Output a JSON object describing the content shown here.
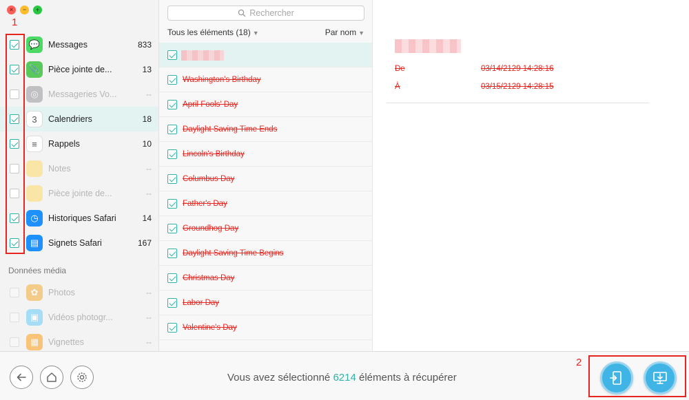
{
  "window_controls": {
    "close": "×",
    "minimize": "−",
    "zoom": "+"
  },
  "sidebar": {
    "items": [
      {
        "label": "Messages",
        "count": "833",
        "checked": true,
        "dim": false,
        "icon": "messages-icon",
        "color": "#4cd964"
      },
      {
        "label": "Pièce jointe de...",
        "count": "13",
        "checked": true,
        "dim": false,
        "icon": "attachment-icon",
        "color": "#5ac85a"
      },
      {
        "label": "Messageries Vo...",
        "count": "--",
        "checked": false,
        "dim": true,
        "icon": "voicemail-icon",
        "color": "#8e8e93"
      },
      {
        "label": "Calendriers",
        "count": "18",
        "checked": true,
        "dim": false,
        "icon": "calendar-icon",
        "color": "#ffffff",
        "selected": true
      },
      {
        "label": "Rappels",
        "count": "10",
        "checked": true,
        "dim": false,
        "icon": "reminders-icon",
        "color": "#ffffff"
      },
      {
        "label": "Notes",
        "count": "--",
        "checked": false,
        "dim": true,
        "icon": "notes-icon",
        "color": "#ffd95a"
      },
      {
        "label": "Pièce jointe de...",
        "count": "--",
        "checked": false,
        "dim": true,
        "icon": "notes-attachment-icon",
        "color": "#ffd95a"
      },
      {
        "label": "Historiques Safari",
        "count": "14",
        "checked": true,
        "dim": false,
        "icon": "safari-history-icon",
        "color": "#1e90ff"
      },
      {
        "label": "Signets Safari",
        "count": "167",
        "checked": true,
        "dim": false,
        "icon": "safari-bookmarks-icon",
        "color": "#1e90ff"
      }
    ],
    "media_section_label": "Données média",
    "media_items": [
      {
        "label": "Photos",
        "count": "--",
        "icon": "photos-icon",
        "color": "#f5a623"
      },
      {
        "label": "Vidéos photogr...",
        "count": "--",
        "icon": "videos-icon",
        "color": "#5ac8fa"
      },
      {
        "label": "Vignettes",
        "count": "--",
        "icon": "thumbnails-icon",
        "color": "#ff9500"
      }
    ],
    "annotation": "1"
  },
  "list": {
    "search_placeholder": "Rechercher",
    "filter_label": "Tous les éléments (18)",
    "sort_label": "Par nom",
    "items": [
      "Washington's Birthday",
      "April Fools' Day",
      "Daylight Saving Time Ends",
      "Lincoln's Birthday",
      "Columbus Day",
      "Father's Day",
      "Groundhog Day",
      "Daylight Saving Time Begins",
      "Christmas Day",
      "Labor Day",
      "Valentine's Day"
    ]
  },
  "detail": {
    "from_label": "De",
    "from_value": "03/14/2129 14:28:16",
    "to_label": "À",
    "to_value": "03/15/2129 14:28:15"
  },
  "bottom": {
    "status_prefix": "Vous avez sélectionné",
    "status_count": "6214",
    "status_suffix": "éléments à récupérer",
    "annotation": "2"
  },
  "colors": {
    "accent": "#2db3a8",
    "deleted": "#e6251f",
    "button": "#40b4e5"
  }
}
